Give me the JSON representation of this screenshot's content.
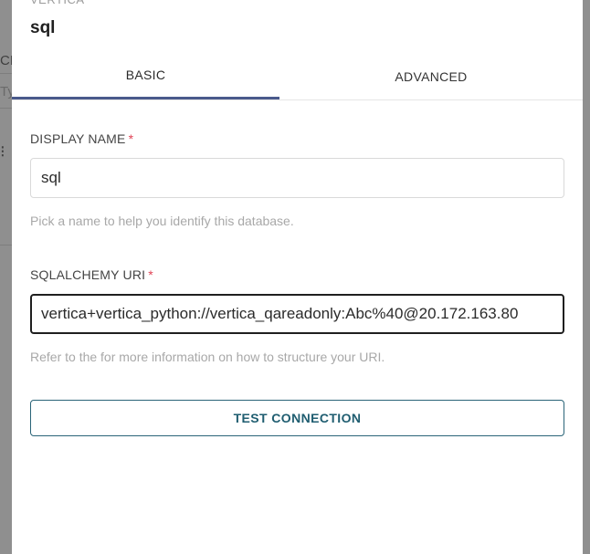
{
  "background": {
    "fragment_1": "CH",
    "fragment_2": "Ty",
    "fragment_3": "⁝"
  },
  "modal": {
    "db_type": "VERTICA",
    "db_name": "sql",
    "tabs": [
      {
        "label": "BASIC",
        "active": true
      },
      {
        "label": "ADVANCED",
        "active": false
      }
    ],
    "display_name": {
      "label": "DISPLAY NAME",
      "required_mark": "*",
      "value": "sql",
      "helper": "Pick a name to help you identify this database."
    },
    "sqlalchemy_uri": {
      "label": "SQLALCHEMY URI",
      "required_mark": "*",
      "value": "vertica+vertica_python://vertica_qareadonly:Abc%40@20.172.163.80",
      "helper": "Refer to the for more information on how to structure your URI."
    },
    "test_connection_label": "TEST CONNECTION"
  },
  "colors": {
    "overlay": "#8f8f8f",
    "active_tab_underline": "#4a5a8c",
    "required": "#e04355",
    "button_text": "#1f5d70"
  }
}
